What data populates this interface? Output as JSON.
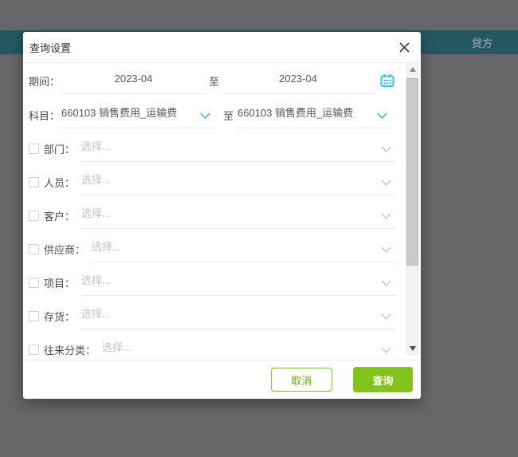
{
  "topbar": {
    "right_label": "贷方"
  },
  "dialog": {
    "title": "查询设置",
    "period": {
      "label": "期间：",
      "from_value": "2023-04",
      "to_word": "至",
      "to_value": "2023-04"
    },
    "subject": {
      "label": "科目：",
      "from_value": "660103 销售费用_运输费",
      "to_word": "至",
      "to_value": "660103 销售费用_运输费"
    },
    "filters": [
      {
        "label": "部门：",
        "placeholder": "选择..."
      },
      {
        "label": "人员：",
        "placeholder": "选择..."
      },
      {
        "label": "客户：",
        "placeholder": "选择..."
      },
      {
        "label": "供应商：",
        "placeholder": "选择..."
      },
      {
        "label": "项目：",
        "placeholder": "选择..."
      },
      {
        "label": "存货：",
        "placeholder": "选择..."
      },
      {
        "label": "往来分类：",
        "placeholder": "选择..."
      }
    ],
    "footer": {
      "cancel_label": "取消",
      "confirm_label": "查询"
    }
  },
  "icons": {
    "close": "close-icon",
    "calendar": "calendar-icon",
    "chevron_down": "chevron-down-icon",
    "scroll_up": "scrollbar-up-icon",
    "scroll_down": "scrollbar-down-icon"
  },
  "colors": {
    "teal": "#235863",
    "green": "#82c41b",
    "cyan": "#41b3e6",
    "calendar_cyan": "#3cc0dc"
  }
}
